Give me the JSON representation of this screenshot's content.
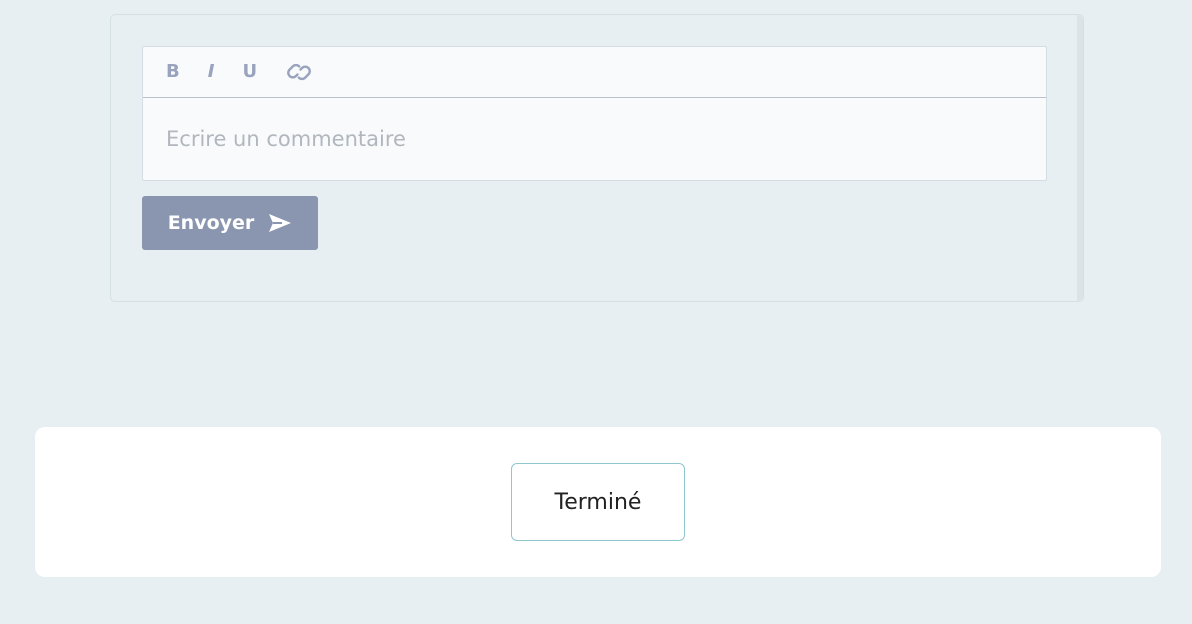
{
  "editor": {
    "toolbar": {
      "bold_label": "B",
      "italic_label": "I",
      "underline_label": "U",
      "link_icon": "link-icon"
    },
    "placeholder": "Ecrire un commentaire",
    "value": ""
  },
  "send_button": {
    "label": "Envoyer",
    "icon": "send-icon"
  },
  "footer": {
    "done_label": "Terminé"
  },
  "colors": {
    "page_background": "#e7eff2",
    "send_button_bg": "#8a95b0",
    "toolbar_icon": "#9aa3bd",
    "done_border": "#8fc7d0"
  }
}
